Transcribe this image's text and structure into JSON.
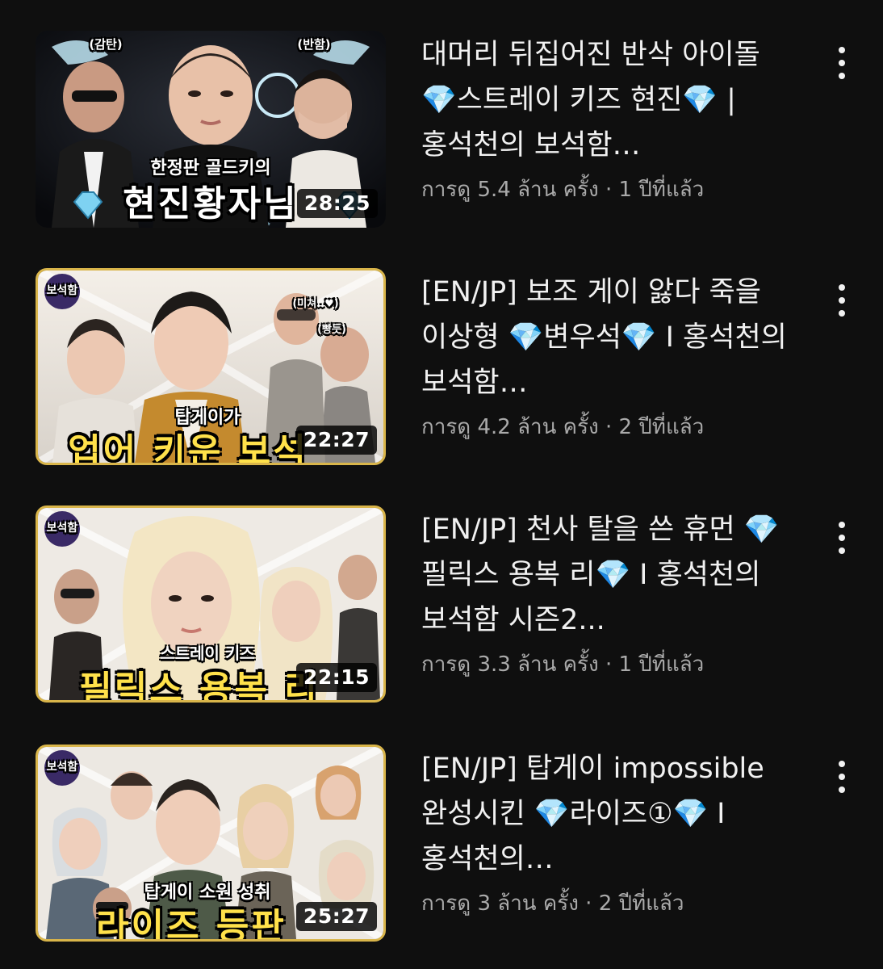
{
  "videos": [
    {
      "title": "대머리 뒤집어진 반삭 아이돌 💎스트레이 키즈 현진💎 | 홍석천의 보석함…",
      "views": "การดู 5.4 ล้าน ครั้ง",
      "separator": "·",
      "age": "1 ปีที่แล้ว",
      "duration": "28:25",
      "thumb_caption_small": "한정판 골드키의",
      "thumb_caption_big": "현진황자님",
      "thumb_label_left": "(감탄)",
      "thumb_label_right": "(반함)",
      "thumb_big_color": "#ffffff"
    },
    {
      "title": "[EN/JP] 보조 게이 앓다 죽을 이상형 💎변우석💎 I 홍석천의 보석함…",
      "views": "การดู 4.2 ล้าน ครั้ง",
      "separator": "·",
      "age": "2 ปีที่แล้ว",
      "duration": "22:27",
      "thumb_caption_small": "탑게이가",
      "thumb_caption_big": "업어 키운 보석",
      "thumb_label_left": "(미쳐..♥)",
      "thumb_label_right": "(빵듯)",
      "thumb_logo": "보석함",
      "thumb_big_color": "#ffe14a"
    },
    {
      "title": "[EN/JP] 천사 탈을 쓴 휴먼 💎필릭스 용복 리💎 I 홍석천의 보석함 시즌2...",
      "views": "การดู 3.3 ล้าน ครั้ง",
      "separator": "·",
      "age": "1 ปีที่แล้ว",
      "duration": "22:15",
      "thumb_caption_small": "스트레이 키즈",
      "thumb_caption_big": "필릭스 용복 리",
      "thumb_logo": "보석함",
      "thumb_big_color": "#ffe14a"
    },
    {
      "title": "[EN/JP] 탑게이 impossible 완성시킨 💎라이즈①💎 I 홍석천의…",
      "views": "การดู 3 ล้าน ครั้ง",
      "separator": "·",
      "age": "2 ปีที่แล้ว",
      "duration": "25:27",
      "thumb_caption_small": "탑게이 소원 성취",
      "thumb_caption_big": "라이즈 등판",
      "thumb_logo": "보석함",
      "thumb_big_color": "#ffe14a"
    }
  ],
  "colors": {
    "background": "#0f0f0f",
    "title": "#f1f1f1",
    "meta": "#aaaaaa",
    "gold_frame": "#d9b54a"
  },
  "icons": {
    "menu": "more-vert-icon",
    "gem": "diamond-icon"
  }
}
